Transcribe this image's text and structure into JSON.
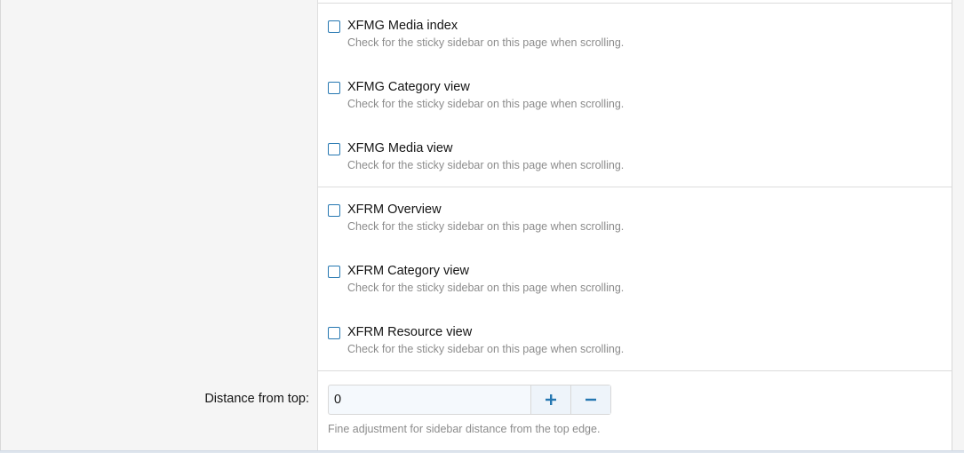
{
  "options": [
    {
      "label": "XFMG Media index",
      "hint": "Check for the sticky sidebar on this page when scrolling.",
      "checked": false
    },
    {
      "label": "XFMG Category view",
      "hint": "Check for the sticky sidebar on this page when scrolling.",
      "checked": false
    },
    {
      "label": "XFMG Media view",
      "hint": "Check for the sticky sidebar on this page when scrolling.",
      "checked": false
    },
    {
      "label": "XFRM Overview",
      "hint": "Check for the sticky sidebar on this page when scrolling.",
      "checked": false
    },
    {
      "label": "XFRM Category view",
      "hint": "Check for the sticky sidebar on this page when scrolling.",
      "checked": false
    },
    {
      "label": "XFRM Resource view",
      "hint": "Check for the sticky sidebar on this page when scrolling.",
      "checked": false
    }
  ],
  "distance": {
    "label": "Distance from top:",
    "value": "0",
    "hint": "Fine adjustment for sidebar distance from the top edge.",
    "increment_icon": "plus-icon",
    "decrement_icon": "minus-icon"
  },
  "colors": {
    "accent": "#2577b1",
    "label_column_bg": "#f5f5f5",
    "hint_text": "#8c8c8c"
  }
}
